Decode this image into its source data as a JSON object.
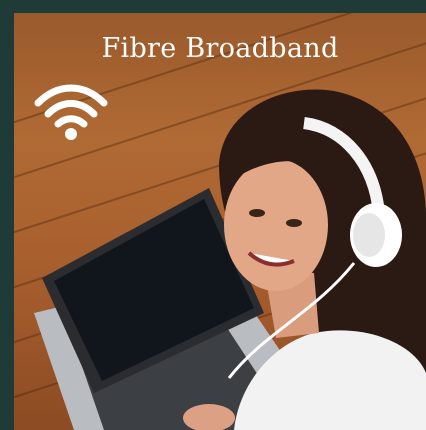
{
  "banner": {
    "title": "Fibre Broadband",
    "icon": "wifi-icon",
    "image": "woman-with-headphones-and-laptop-photo"
  },
  "colors": {
    "frame": "#1f3b38",
    "title_text": "#ffffff",
    "wood": "#a85f2e"
  }
}
